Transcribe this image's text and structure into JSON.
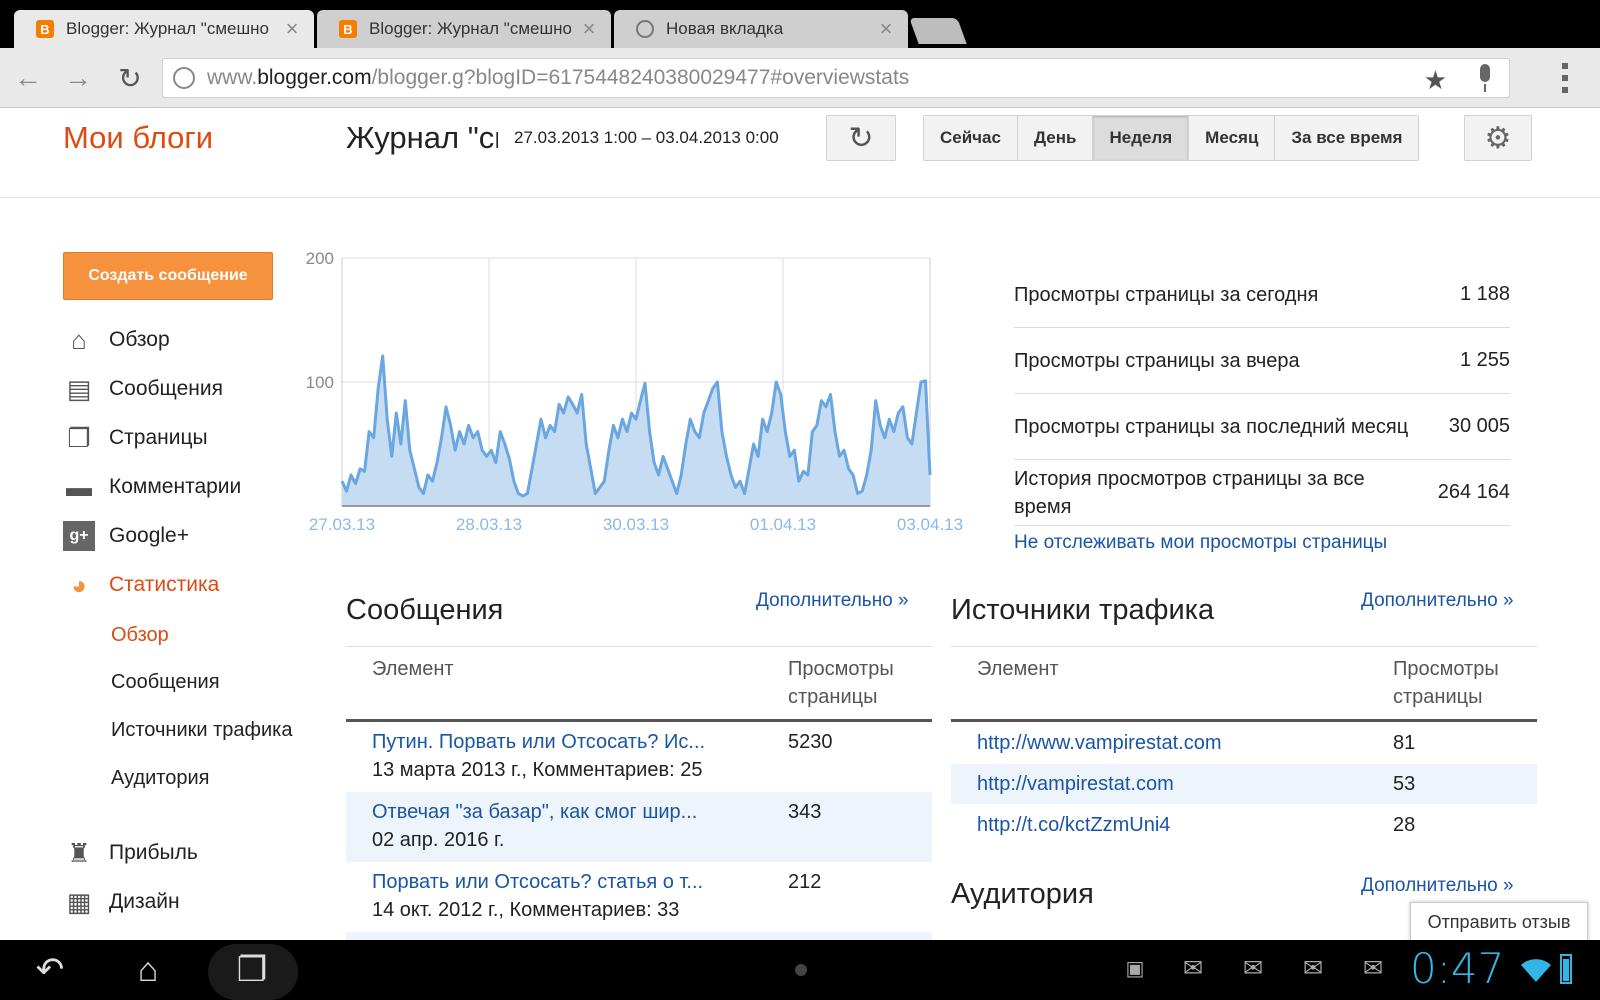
{
  "browser": {
    "tabs": [
      {
        "title": "Blogger: Журнал \"смешно",
        "favicon": "blogger-icon",
        "active": true
      },
      {
        "title": "Blogger: Журнал \"смешно",
        "favicon": "blogger-icon",
        "active": false
      },
      {
        "title": "Новая вкладка",
        "favicon": "globe-icon",
        "active": false
      }
    ],
    "url_prefix": "www.",
    "url_domain": "blogger.com",
    "url_path": "/blogger.g?blogID=6175448240380029477#overviewstats"
  },
  "header": {
    "my_blogs": "Мои блоги",
    "blog_name": "Журнал \"смешно",
    "date_range": "27.03.2013 1:00 – 03.04.2013 0:00",
    "ranges": [
      "Сейчас",
      "День",
      "Неделя",
      "Месяц",
      "За все время"
    ],
    "active_range": "Неделя"
  },
  "sidebar": {
    "create_button": "Создать сообщение",
    "items": [
      {
        "label": "Обзор",
        "icon": "home-icon"
      },
      {
        "label": "Сообщения",
        "icon": "posts-icon"
      },
      {
        "label": "Страницы",
        "icon": "pages-icon"
      },
      {
        "label": "Комментарии",
        "icon": "comments-icon"
      },
      {
        "label": "Google+",
        "icon": "google-plus-icon"
      },
      {
        "label": "Статистика",
        "icon": "stats-pie-icon"
      }
    ],
    "stats_subitems": [
      "Обзор",
      "Сообщения",
      "Источники трафика",
      "Аудитория"
    ],
    "items_after": [
      {
        "label": "Прибыль",
        "icon": "trophy-icon"
      },
      {
        "label": "Дизайн",
        "icon": "layout-icon"
      }
    ]
  },
  "chart_data": {
    "type": "area",
    "x_tick_labels": [
      "27.03.13",
      "28.03.13",
      "30.03.13",
      "01.04.13",
      "03.04.13"
    ],
    "y_tick_labels": [
      "200",
      "100"
    ],
    "ylim": [
      0,
      200
    ],
    "grid": true,
    "fill_color": "#c6dcf2",
    "line_color": "#6aa6e0",
    "values": [
      20,
      12,
      25,
      18,
      30,
      28,
      60,
      55,
      95,
      121,
      70,
      40,
      75,
      50,
      85,
      45,
      30,
      15,
      10,
      25,
      20,
      35,
      55,
      80,
      65,
      45,
      60,
      50,
      65,
      55,
      60,
      45,
      40,
      45,
      35,
      60,
      50,
      38,
      20,
      10,
      8,
      10,
      30,
      50,
      70,
      55,
      65,
      60,
      82,
      75,
      88,
      82,
      75,
      90,
      50,
      30,
      10,
      15,
      20,
      45,
      65,
      55,
      70,
      60,
      75,
      70,
      85,
      99,
      60,
      35,
      25,
      40,
      30,
      20,
      10,
      25,
      50,
      70,
      60,
      55,
      75,
      85,
      95,
      100,
      60,
      40,
      25,
      15,
      20,
      10,
      30,
      50,
      40,
      70,
      60,
      75,
      100,
      90,
      60,
      40,
      45,
      20,
      28,
      25,
      60,
      65,
      85,
      80,
      90,
      60,
      40,
      45,
      30,
      25,
      10,
      12,
      25,
      45,
      85,
      65,
      55,
      70,
      60,
      75,
      80,
      55,
      50,
      75,
      100,
      101,
      25
    ]
  },
  "stats": [
    {
      "label": "Просмотры страницы за сегодня",
      "value": "1 188"
    },
    {
      "label": "Просмотры страницы за вчера",
      "value": "1 255"
    },
    {
      "label": "Просмотры страницы за последний месяц",
      "value": "30 005"
    },
    {
      "label": "История просмотров страницы за все время",
      "value": "264 164"
    }
  ],
  "no_track_link": "Не отслеживать мои просмотры страницы",
  "posts": {
    "title": "Сообщения",
    "more": "Дополнительно »",
    "col_element": "Элемент",
    "col_views": "Просмотры страницы",
    "rows": [
      {
        "title": "Путин. Порвать или Отсосать? Ис...",
        "meta": "13 марта 2013 г., Комментариев: 25",
        "views": "5230"
      },
      {
        "title": "Отвечая \"за базар\", как смог шир...",
        "meta": "02 апр. 2016 г.",
        "views": "343"
      },
      {
        "title": "Порвать или Отсосать? статья о т...",
        "meta": "14 окт. 2012 г., Комментариев: 33",
        "views": "212"
      }
    ]
  },
  "traffic": {
    "title": "Источники трафика",
    "more": "Дополнительно »",
    "col_element": "Элемент",
    "col_views": "Просмотры страницы",
    "rows": [
      {
        "url": "http://www.vampirestat.com",
        "views": "81"
      },
      {
        "url": "http://vampirestat.com",
        "views": "53"
      },
      {
        "url": "http://t.co/kctZzmUni4",
        "views": "28"
      }
    ]
  },
  "audience": {
    "title": "Аудитория",
    "more": "Дополнительно »"
  },
  "feedback_button": "Отправить отзыв",
  "system": {
    "clock": "0:47"
  }
}
